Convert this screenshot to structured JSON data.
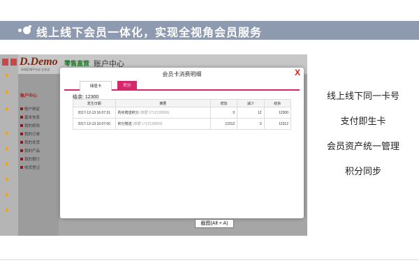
{
  "banner": {
    "title": "线上线下会员一体化，实现全视角会员服务"
  },
  "background_app": {
    "logo": "D.Demo",
    "logo_sub": "未知区域不分店·企业店",
    "retail_label": "零售直营",
    "account_center": "账户中心",
    "sidebar_head": "账户中心",
    "sidebar_items": [
      "账户绑定",
      "基本信息",
      "我的修改",
      "我的订单",
      "我的发货",
      "我的产品",
      "我的银行",
      "收货登记"
    ]
  },
  "modal": {
    "title": "会员卡消费明细",
    "close_label": "X",
    "tabs": [
      {
        "label": "储值卡",
        "active": false
      },
      {
        "label": "积分",
        "active": true
      }
    ],
    "balance_label": "结余:",
    "balance_value": "12300",
    "columns": [
      "发生日期",
      "摘要",
      "增加",
      "减少",
      "结余"
    ],
    "rows": [
      {
        "date": "2017-12-13 16:07:31",
        "summary": "购买赠送积分",
        "phone": "(单据 1712130006)",
        "increase": "0",
        "decrease": "12",
        "balance": "12300"
      },
      {
        "date": "2017-12-13 16:07:06",
        "summary": "积分赠送",
        "phone": "(单据 1712130003)",
        "increase": "12312",
        "decrease": "0",
        "balance": "12312"
      }
    ]
  },
  "screenshot_hint": "截图(Alt + A)",
  "features": [
    "线上线下同一卡号",
    "支付即生卡",
    "会员资产统一管理",
    "积分同步"
  ],
  "colors": {
    "banner": "#8e9ab0",
    "accent": "#d4276c",
    "close": "#e31b1b"
  }
}
